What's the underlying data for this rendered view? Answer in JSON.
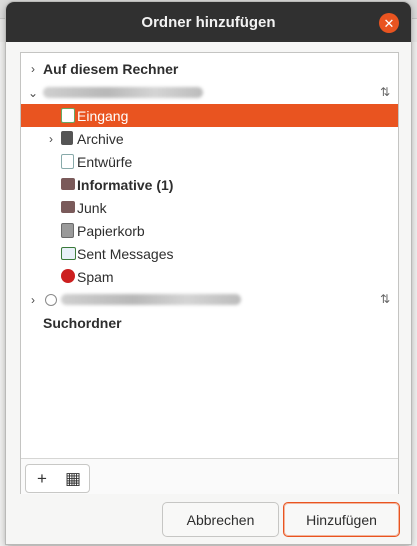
{
  "dialog": {
    "title": "Ordner hinzufügen",
    "close_glyph": "✕"
  },
  "tree": {
    "local_header": "Auf diesem Rechner",
    "folders": [
      {
        "name": "Eingang",
        "icon": "inbox-icon",
        "selected": true
      },
      {
        "name": "Archive",
        "icon": "archive-icon",
        "expandable": true
      },
      {
        "name": "Entwürfe",
        "icon": "drafts-icon"
      },
      {
        "name": "Informative (1)",
        "icon": "folder-icon",
        "bold": true
      },
      {
        "name": "Junk",
        "icon": "folder-icon"
      },
      {
        "name": "Papierkorb",
        "icon": "trash-icon"
      },
      {
        "name": "Sent Messages",
        "icon": "sent-icon"
      },
      {
        "name": "Spam",
        "icon": "spam-icon"
      }
    ],
    "search_folders_label": "Suchordner"
  },
  "toolbar": {
    "add_glyph": "+",
    "remove_glyph": "▦"
  },
  "buttons": {
    "cancel": "Abbrechen",
    "add": "Hinzufügen"
  },
  "colors": {
    "accent": "#e95420",
    "titlebar": "#303030"
  }
}
